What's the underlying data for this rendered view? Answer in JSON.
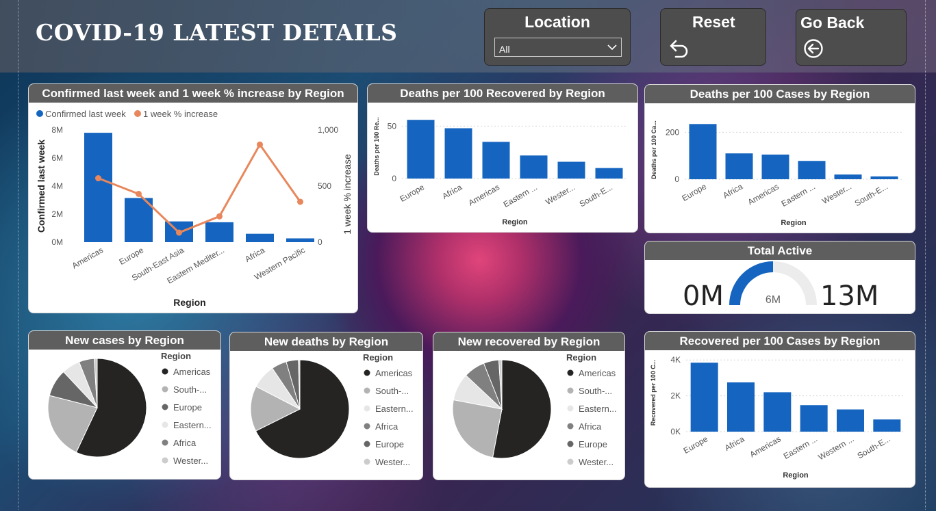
{
  "header": {
    "title": "COVID-19 LATEST DETAILS",
    "location": {
      "label": "Location",
      "selected": "All"
    },
    "reset_label": "Reset",
    "goback_label": "Go Back"
  },
  "icons": {
    "dropdown": "chevron-down-icon",
    "reset": "undo-arrow-icon",
    "goback": "circle-left-arrow-icon"
  },
  "colors": {
    "bar": "#1565c0",
    "line": "#e8875b",
    "header": "#5e5e5e"
  },
  "chart_data": [
    {
      "id": "combo",
      "type": "bar+line",
      "title": "Confirmed last week and 1 week % increase by Region",
      "categories": [
        "Americas",
        "Europe",
        "South-East Asia",
        "Eastern Mediter...",
        "Africa",
        "Western Pacific"
      ],
      "series": [
        {
          "name": "Confirmed last week",
          "type": "bar",
          "values": [
            7800000,
            3150000,
            1480000,
            1420000,
            600000,
            270000
          ]
        },
        {
          "name": "1 week % increase",
          "type": "line",
          "values": [
            570,
            430,
            85,
            230,
            870,
            360
          ]
        }
      ],
      "xlabel": "Region",
      "ylabel": "Confirmed last week",
      "y2label": "1 week % increase",
      "ylim": [
        0,
        8000000
      ],
      "y2lim": [
        0,
        1000
      ],
      "yticks": [
        "0M",
        "2M",
        "4M",
        "6M",
        "8M"
      ],
      "y2ticks": [
        "0",
        "500",
        "1,000"
      ]
    },
    {
      "id": "dpr",
      "type": "bar",
      "title": "Deaths per 100 Recovered by Region",
      "categories": [
        "Europe",
        "Africa",
        "Americas",
        "Eastern ...",
        "Wester...",
        "South-E..."
      ],
      "values": [
        56,
        48,
        35,
        22,
        16,
        10
      ],
      "xlabel": "Region",
      "ylabel": "Deaths per 100 Re...",
      "ylim": [
        0,
        62
      ],
      "yticks": [
        "0",
        "50"
      ]
    },
    {
      "id": "dpc",
      "type": "bar",
      "title": "Deaths per 100 Cases by Region",
      "categories": [
        "Europe",
        "Africa",
        "Americas",
        "Eastern ...",
        "Wester...",
        "South-E..."
      ],
      "values": [
        235,
        110,
        105,
        78,
        20,
        12
      ],
      "xlabel": "Region",
      "ylabel": "Deaths per 100 Ca...",
      "ylim": [
        0,
        265
      ],
      "yticks": [
        "0",
        "200"
      ]
    },
    {
      "id": "gauge",
      "type": "gauge",
      "title": "Total Active",
      "min_label": "0M",
      "max_label": "13M",
      "target_label": "6M",
      "fraction": 0.5
    },
    {
      "id": "rpc",
      "type": "bar",
      "title": "Recovered per 100 Cases by Region",
      "categories": [
        "Europe",
        "Africa",
        "Americas",
        "Eastern ...",
        "Western ...",
        "South-E..."
      ],
      "values": [
        3850,
        2750,
        2200,
        1480,
        1240,
        680
      ],
      "xlabel": "Region",
      "ylabel": "Recovered per 100 C...",
      "ylim": [
        0,
        4200
      ],
      "yticks": [
        "0K",
        "2K",
        "4K"
      ]
    },
    {
      "id": "pie1",
      "type": "pie",
      "title": "New cases by Region",
      "legend_title": "Region",
      "labels": [
        "Americas",
        "South-...",
        "Europe",
        "Eastern...",
        "Africa",
        "Wester..."
      ],
      "values": [
        57,
        22,
        9,
        6,
        5,
        1
      ],
      "colors": [
        "#252423",
        "#b3b3b3",
        "#666666",
        "#e6e6e6",
        "#808080",
        "#cccccc"
      ]
    },
    {
      "id": "pie2",
      "type": "pie",
      "title": "New deaths by Region",
      "legend_title": "Region",
      "labels": [
        "Americas",
        "South-...",
        "Eastern...",
        "Africa",
        "Europe",
        "Wester..."
      ],
      "values": [
        68,
        15,
        8,
        5,
        4,
        0.5
      ],
      "colors": [
        "#252423",
        "#b3b3b3",
        "#e6e6e6",
        "#808080",
        "#666666",
        "#cccccc"
      ]
    },
    {
      "id": "pie3",
      "type": "pie",
      "title": "New recovered by Region",
      "legend_title": "Region",
      "labels": [
        "Americas",
        "South-...",
        "Eastern...",
        "Africa",
        "Europe",
        "Wester..."
      ],
      "values": [
        53,
        25,
        9,
        7,
        5,
        1
      ],
      "colors": [
        "#252423",
        "#b3b3b3",
        "#e6e6e6",
        "#808080",
        "#666666",
        "#cccccc"
      ]
    }
  ]
}
